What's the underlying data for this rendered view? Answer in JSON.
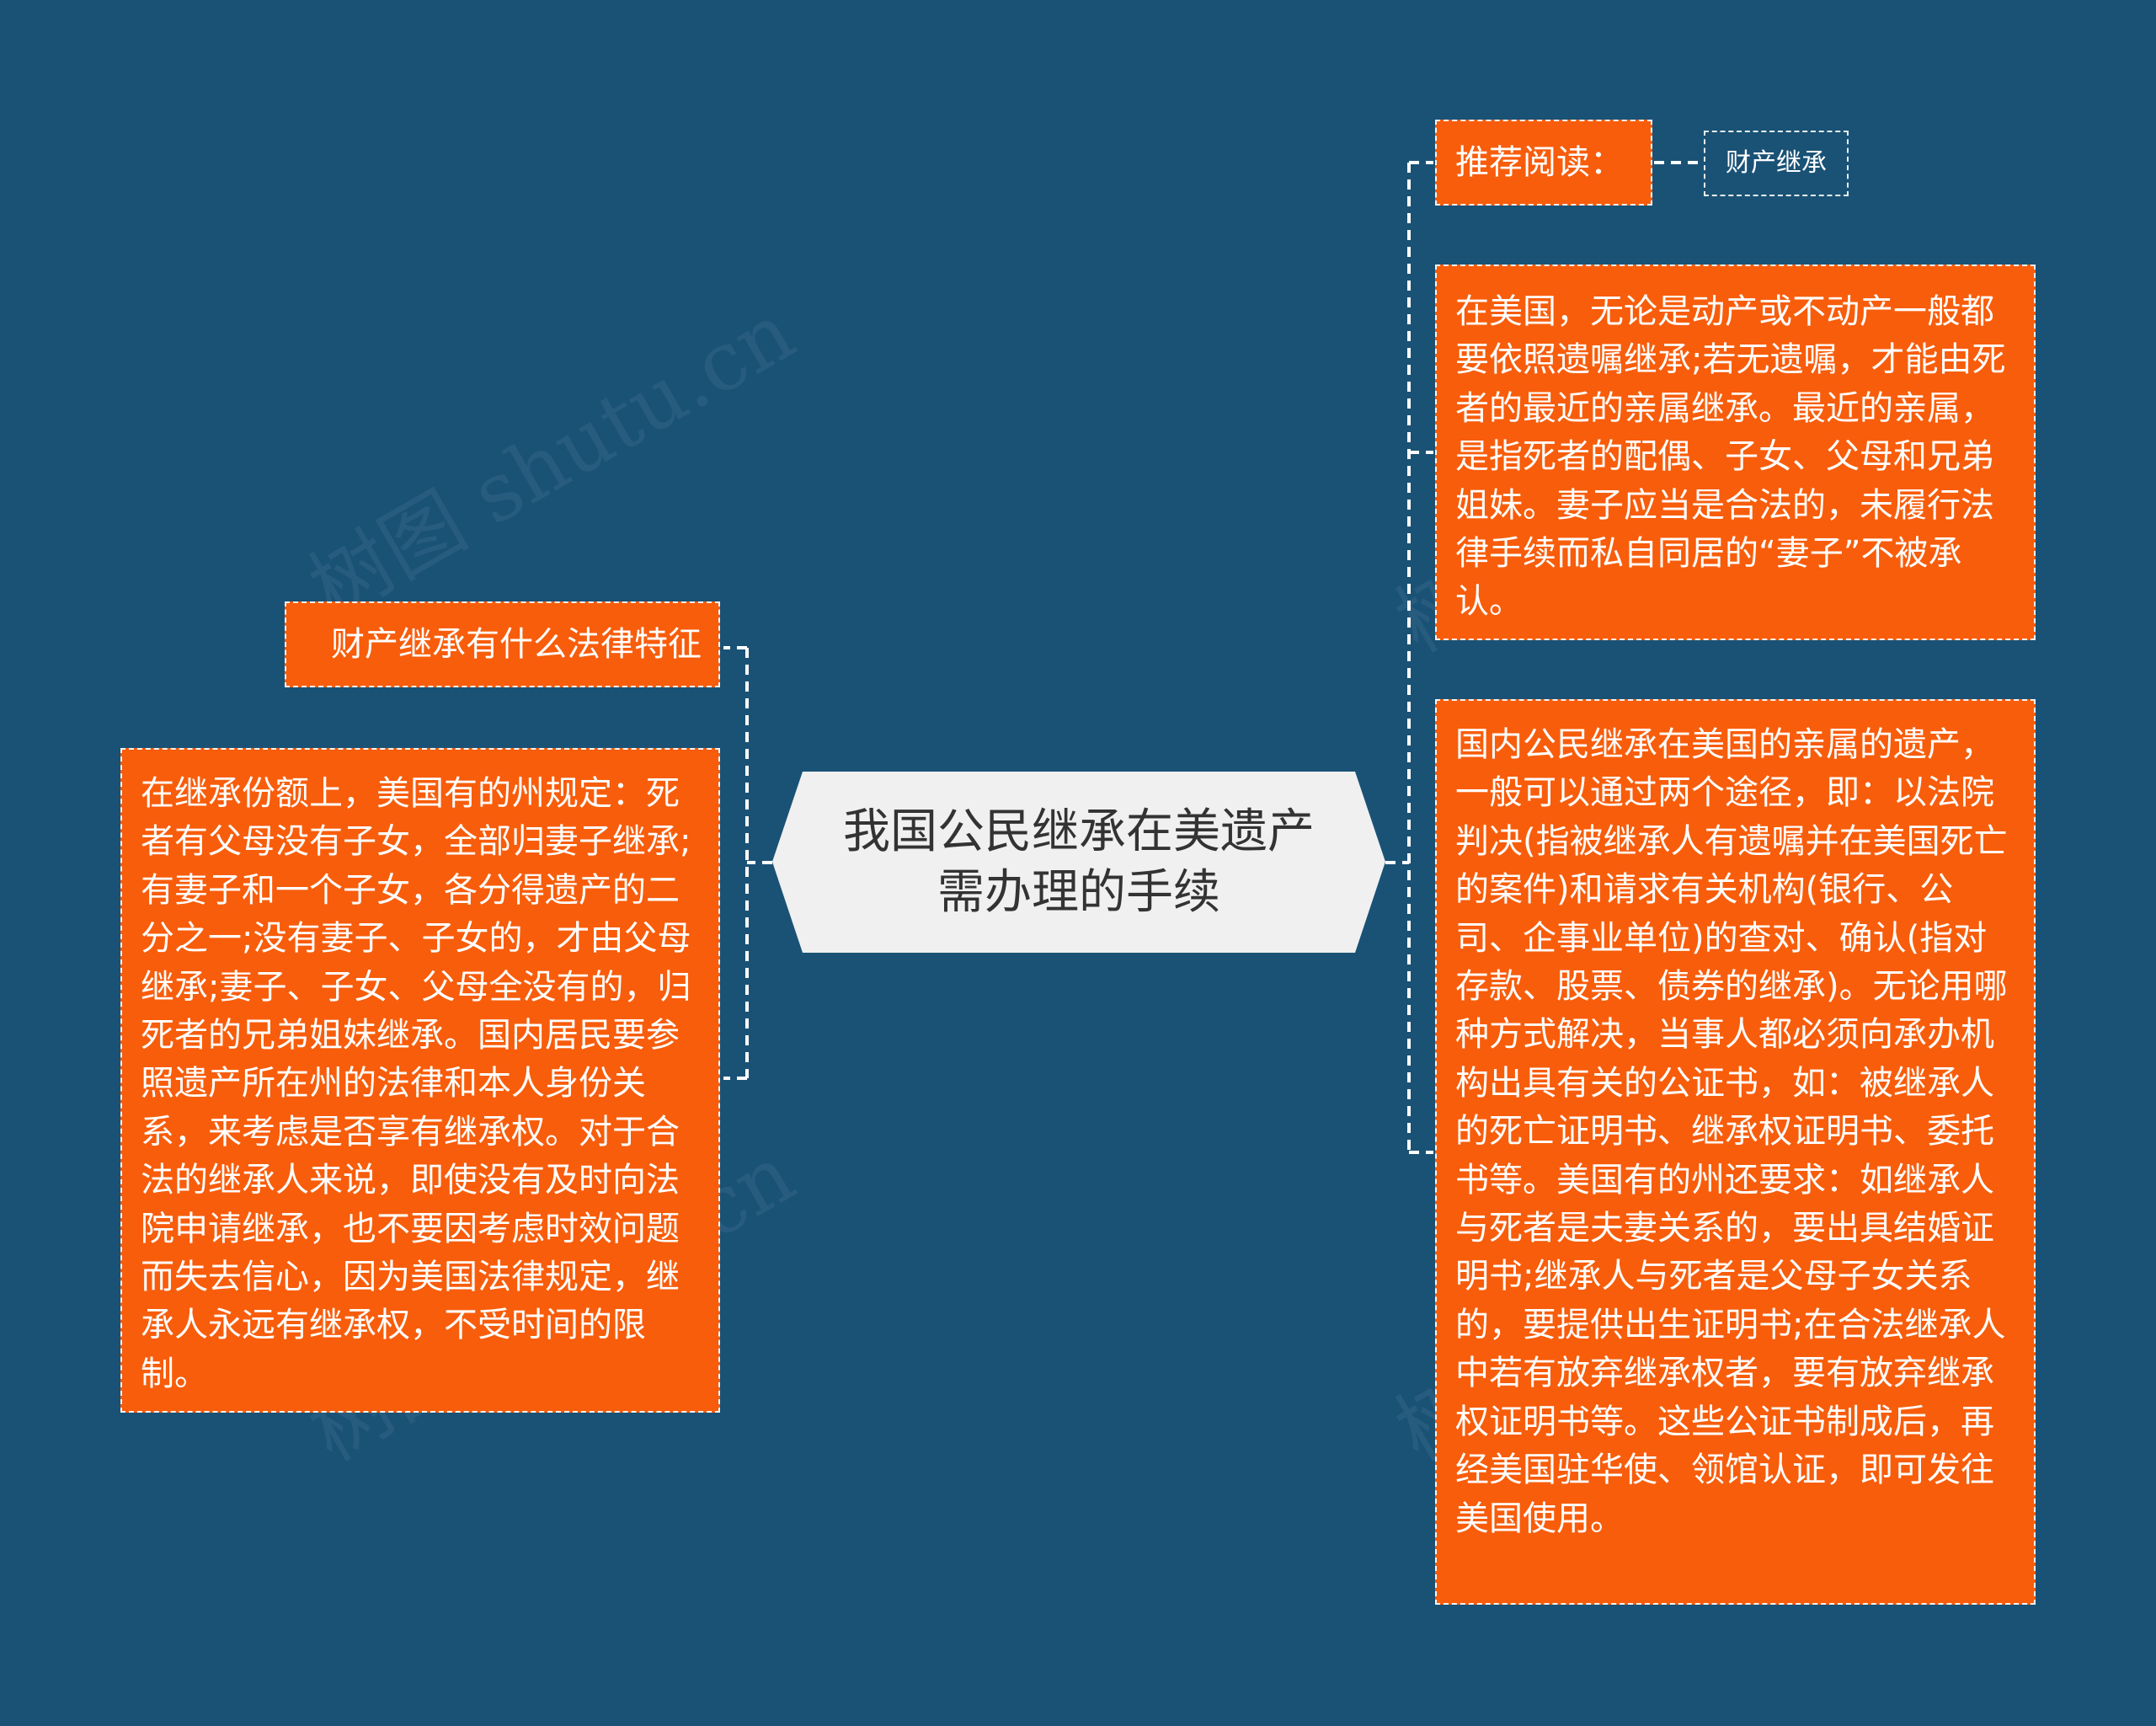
{
  "colors": {
    "background": "#1a5276",
    "node_fill": "#f85d0b",
    "central_fill": "#f0f0f0",
    "connector": "#ffffff"
  },
  "central": {
    "text": "我国公民继承在美遗产需办理的手续"
  },
  "left": {
    "title": "财产继承有什么法律特征",
    "body": "在继承份额上，美国有的州规定：死者有父母没有子女，全部归妻子继承;有妻子和一个子女，各分得遗产的二分之一;没有妻子、子女的，才由父母继承;妻子、子女、父母全没有的，归死者的兄弟姐妹继承。国内居民要参照遗产所在州的法律和本人身份关系，来考虑是否享有继承权。对于合法的继承人来说，即使没有及时向法院申请继承，也不要因考虑时效问题而失去信心，因为美国法律规定，继承人永远有继承权，不受时间的限制。"
  },
  "right": {
    "recommend_label": "推荐阅读：",
    "recommend_link": "财产继承",
    "node1": "在美国，无论是动产或不动产一般都要依照遗嘱继承;若无遗嘱，才能由死者的最近的亲属继承。最近的亲属，是指死者的配偶、子女、父母和兄弟姐妹。妻子应当是合法的，未履行法律手续而私自同居的“妻子”不被承认。",
    "node2": "国内公民继承在美国的亲属的遗产，一般可以通过两个途径，即：以法院判决(指被继承人有遗嘱并在美国死亡的案件)和请求有关机构(银行、公司、企事业单位)的查对、确认(指对存款、股票、债券的继承)。无论用哪种方式解决，当事人都必须向承办机构出具有关的公证书，如：被继承人的死亡证明书、继承权证明书、委托书等。美国有的州还要求：如继承人与死者是夫妻关系的，要出具结婚证明书;继承人与死者是父母子女关系的，要提供出生证明书;在合法继承人中若有放弃继承权者，要有放弃继承权证明书等。这些公证书制成后，再经美国驻华使、领馆认证，即可发往美国使用。"
  },
  "watermark": "树图 shutu.cn"
}
